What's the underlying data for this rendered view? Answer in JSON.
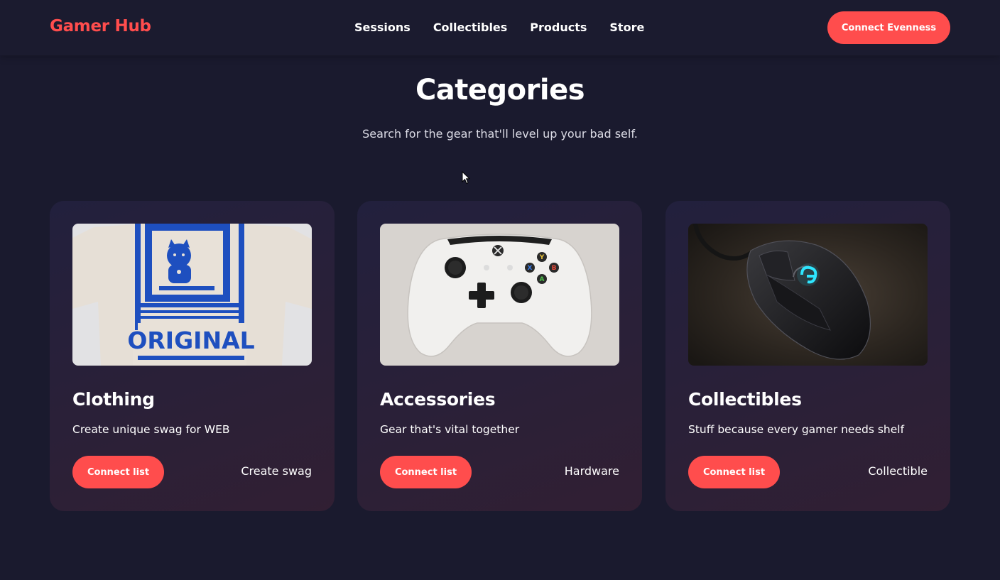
{
  "header": {
    "logo": "Gamer Hub",
    "nav": [
      "Sessions",
      "Collectibles",
      "Products",
      "Store"
    ],
    "cta_label": "Connect Evenness"
  },
  "section": {
    "title": "Categories",
    "subtitle": "Search for the gear that'll level up your bad self."
  },
  "cards": [
    {
      "title": "Clothing",
      "description": "Create unique swag for WEB",
      "button_label": "Connect list",
      "tag": "Create swag",
      "image": "tshirt-photo",
      "image_text": "ORIGINAL"
    },
    {
      "title": "Accessories",
      "description": "Gear that's vital together",
      "button_label": "Connect list",
      "tag": "Hardware",
      "image": "controller-photo"
    },
    {
      "title": "Collectibles",
      "description": "Stuff because every gamer needs shelf",
      "button_label": "Connect list",
      "tag": "Collectible",
      "image": "mouse-photo"
    }
  ],
  "colors": {
    "background": "#1a1a2e",
    "accent": "#ff4d4d",
    "card": "#25203a"
  }
}
